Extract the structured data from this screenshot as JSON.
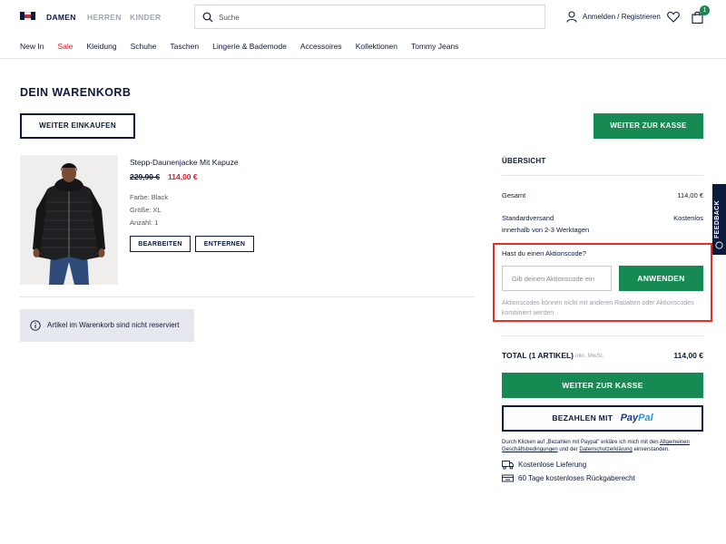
{
  "header": {
    "genders": [
      "DAMEN",
      "HERREN",
      "KINDER"
    ],
    "search_placeholder": "Suche",
    "login": "Anmelden / Registrieren",
    "cart_count": "1"
  },
  "nav": [
    "New In",
    "Sale",
    "Kleidung",
    "Schuhe",
    "Taschen",
    "Lingerie & Bademode",
    "Accessoires",
    "Kollektionen",
    "Tommy Jeans"
  ],
  "page_title": "DEIN WARENKORB",
  "buttons": {
    "continue_shopping": "WEITER EINKAUFEN",
    "checkout_top": "WEITER ZUR KASSE",
    "checkout": "WEITER ZUR KASSE",
    "edit": "BEARBEITEN",
    "remove": "ENTFERNEN",
    "apply": "ANWENDEN",
    "paypal_label": "BEZAHLEN MIT"
  },
  "product": {
    "name": "Stepp-Daunenjacke Mit Kapuze",
    "price_old": "229,90 €",
    "price_new": "114,00 €",
    "color": "Farbe: Black",
    "size": "Größe: XL",
    "qty": "Anzahl: 1"
  },
  "notice": "Artikel im Warenkorb sind nicht reserviert",
  "summary": {
    "title": "ÜBERSICHT",
    "total_label": "Gesamt",
    "total_value": "114,00 €",
    "shipping_label": "Standardversand",
    "shipping_value": "Kostenlos",
    "shipping_time": "innerhalb von 2-3 Werktagen",
    "promo_question": "Hast du einen Aktionscode?",
    "promo_placeholder": "Gib deinen Aktionscode ein",
    "promo_note": "Aktionscodes können nicht mit anderen Rabatten oder Aktionscodes kombiniert werden.",
    "grand_total_label": "TOTAL (1 ARTIKEL)",
    "vat_note": "inkl. MwSt.",
    "grand_total_value": "114,00 €",
    "legal_pre": "Durch Klicken auf „Bezahlen mit Paypal\" erkläre ich mich mit den ",
    "legal_link1": "Allgemeinen Geschäftsbedingungen",
    "legal_mid": " und der ",
    "legal_link2": "Datenschutzerklärung",
    "legal_post": " einverstanden.",
    "perk1": "Kostenlose Lieferung",
    "perk2": "60 Tage kostenloses Rückgaberecht"
  },
  "paypal": {
    "p1": "Pay",
    "p2": "Pal"
  },
  "feedback": "FEEDBACK",
  "colors": {
    "navy": "#0b1a3b",
    "green": "#168a52",
    "red": "#d11f31",
    "highlight": "#ea2e23"
  }
}
